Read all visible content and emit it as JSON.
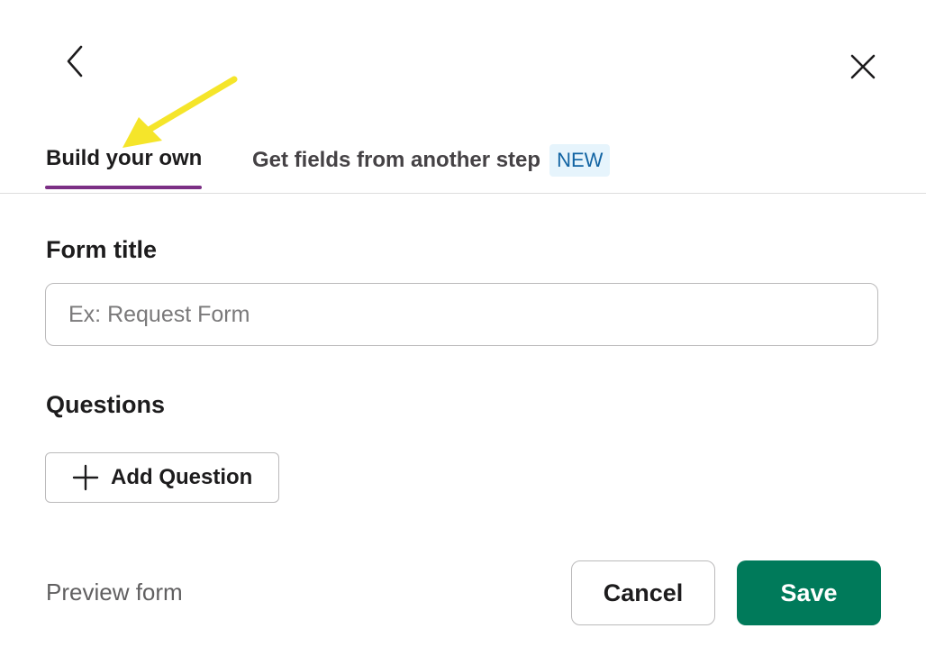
{
  "header": {
    "back_icon": "chevron-left-icon",
    "close_icon": "close-icon"
  },
  "tabs": [
    {
      "label": "Build your own",
      "active": true
    },
    {
      "label": "Get fields from another step",
      "badge": "NEW",
      "active": false
    }
  ],
  "form": {
    "title_label": "Form title",
    "title_placeholder": "Ex: Request Form",
    "title_value": "",
    "questions_label": "Questions",
    "add_question_label": "Add Question",
    "add_question_icon": "plus-icon"
  },
  "footer": {
    "preview_label": "Preview form",
    "cancel_label": "Cancel",
    "save_label": "Save"
  },
  "colors": {
    "accent_tab": "#7c3085",
    "save": "#007a5a",
    "badge_bg": "#e6f4fc",
    "badge_text": "#1264a3",
    "annotation": "#f5e52a"
  }
}
